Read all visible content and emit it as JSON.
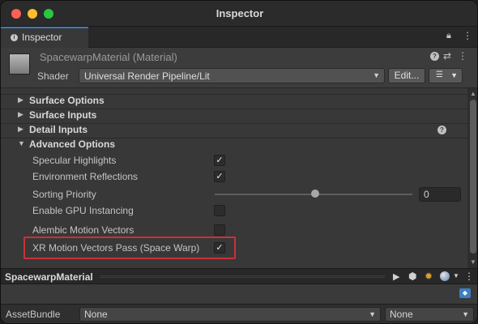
{
  "window": {
    "title": "Inspector"
  },
  "tab": {
    "label": "Inspector",
    "icon": "info-icon"
  },
  "header": {
    "material_name": "SpacewarpMaterial (Material)",
    "shader_label": "Shader",
    "shader_value": "Universal Render Pipeline/Lit",
    "edit_label": "Edit..."
  },
  "sections": {
    "surface_options": "Surface Options",
    "surface_inputs": "Surface Inputs",
    "detail_inputs": "Detail Inputs",
    "advanced_options": "Advanced Options"
  },
  "properties": {
    "specular_highlights": {
      "label": "Specular Highlights",
      "checked": true
    },
    "environment_reflections": {
      "label": "Environment Reflections",
      "checked": true
    },
    "sorting_priority": {
      "label": "Sorting Priority",
      "value": "0"
    },
    "gpu_instancing": {
      "label": "Enable GPU Instancing",
      "checked": false
    },
    "alembic_motion_vectors": {
      "label": "Alembic Motion Vectors",
      "checked": false
    },
    "xr_motion_vectors": {
      "label": "XR Motion Vectors Pass (Space Warp)",
      "checked": true
    }
  },
  "preview": {
    "name": "SpacewarpMaterial"
  },
  "assetbundle": {
    "label": "AssetBundle",
    "name_value": "None",
    "variant_value": "None"
  },
  "colors": {
    "accent": "#3a79bb",
    "highlight": "#c8323a",
    "background": "#383838"
  }
}
